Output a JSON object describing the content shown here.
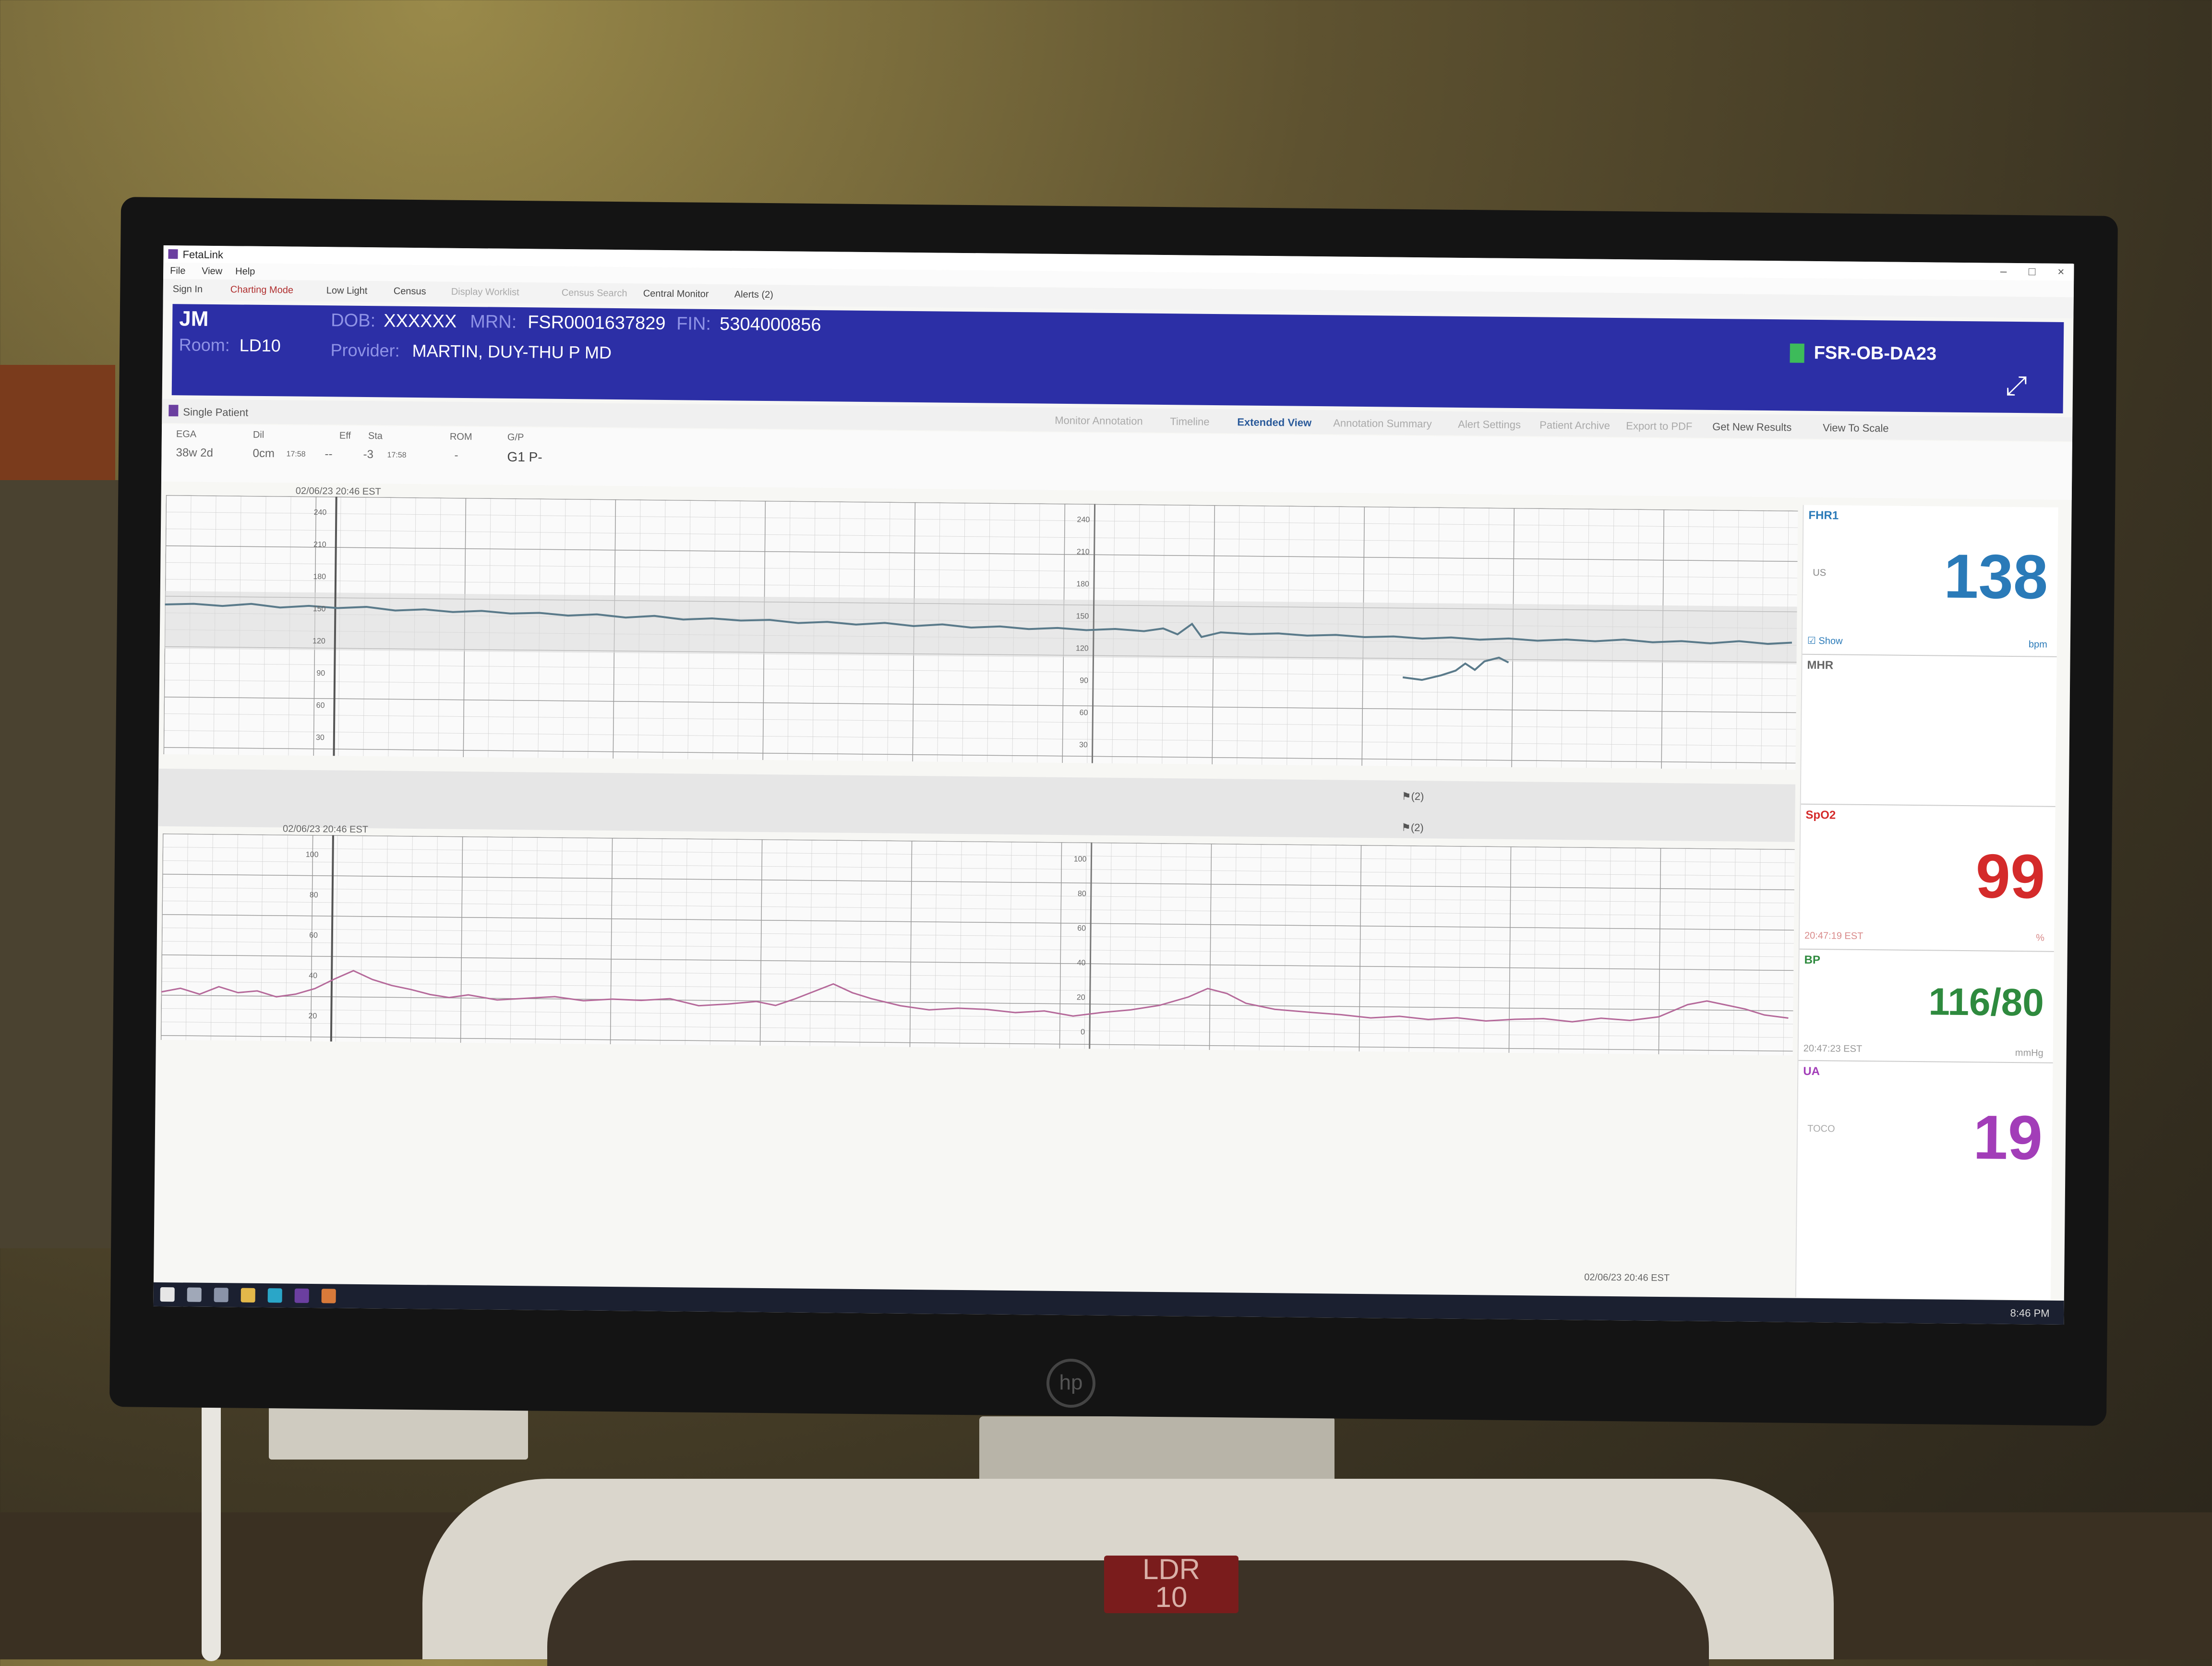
{
  "window": {
    "title": "FetaLink",
    "menu": [
      "File",
      "View",
      "Help"
    ],
    "toolbar": [
      "Sign In",
      "Charting Mode",
      "Low Light",
      "Census",
      "Display Worklist",
      "Census Search",
      "Central Monitor",
      "Alerts (2)"
    ]
  },
  "banner": {
    "initials": "JM",
    "room_label": "Room:",
    "room": "LD10",
    "dob_label": "DOB:",
    "dob": "XXXXXX",
    "mrn_label": "MRN:",
    "mrn": "FSR0001637829",
    "fin_label": "FIN:",
    "fin": "5304000856",
    "provider_label": "Provider:",
    "provider": "MARTIN, DUY-THU P MD",
    "station": "FSR-OB-DA23"
  },
  "tabs": {
    "single_patient": "Single Patient",
    "actions": [
      "Monitor Annotation",
      "Timeline",
      "Extended View",
      "Annotation Summary",
      "Alert Settings",
      "Patient Archive",
      "Export to PDF",
      "Get New Results",
      "View To Scale"
    ]
  },
  "patient_info": {
    "ega_label": "EGA",
    "ega": "38w 2d",
    "dil_label": "Dil",
    "dil": "0cm",
    "dil_time": "17:58",
    "eff_label": "Eff",
    "eff": "--",
    "sta_label": "Sta",
    "sta": "-3",
    "sta_time": "17:58",
    "rom_label": "ROM",
    "rom": "-",
    "gp_label": "G/P",
    "gp": "G1 P-"
  },
  "fhr_strip": {
    "timestamp": "02/06/23 20:46 EST",
    "axis_left": [
      "240",
      "210",
      "180",
      "150",
      "120",
      "90",
      "60",
      "30"
    ],
    "axis_mid": [
      "240",
      "210",
      "180",
      "150",
      "120",
      "90",
      "60",
      "30"
    ]
  },
  "ua_strip": {
    "timestamp": "02/06/23 20:46 EST",
    "axis_left": [
      "100",
      "80",
      "60",
      "40",
      "20"
    ],
    "axis_mid": [
      "100",
      "80",
      "60",
      "40",
      "20",
      "0"
    ]
  },
  "markers": [
    "(2)",
    "(2)"
  ],
  "footer_timestamp": "02/06/23 20:46 EST",
  "vitals": {
    "fhr": {
      "name": "FHR1",
      "mode": "US",
      "value": "138",
      "show": "Show",
      "unit": "bpm",
      "color": "#2a7ab8"
    },
    "mhr": {
      "name": "MHR"
    },
    "spo2": {
      "name": "SpO2",
      "value": "99",
      "time": "20:47:19 EST",
      "unit": "%",
      "color": "#d42a2a"
    },
    "bp": {
      "name": "BP",
      "value": "116/80",
      "time": "20:47:23 EST",
      "unit": "mmHg",
      "color": "#2e8a3e"
    },
    "ua": {
      "name": "UA",
      "mode": "TOCO",
      "value": "19",
      "color": "#a23db8"
    }
  },
  "taskbar": {
    "clock": "8:46 PM"
  }
}
